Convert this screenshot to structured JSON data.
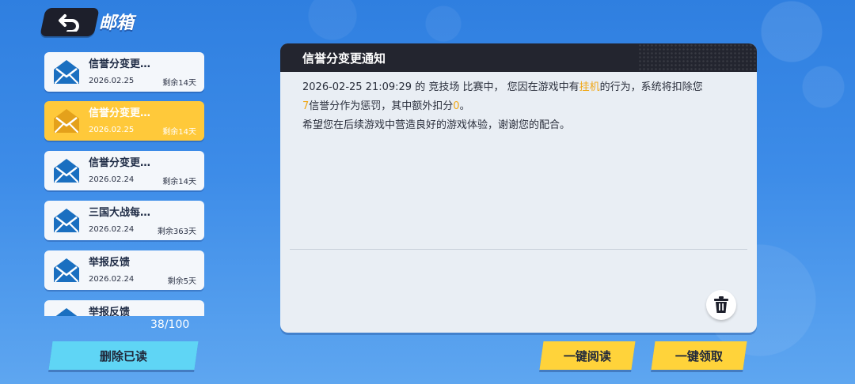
{
  "header": {
    "title": "邮箱",
    "back_icon": "back-arrow-icon"
  },
  "mail_list": {
    "items": [
      {
        "title": "信誉分变更…",
        "date": "2026.02.25",
        "remaining": "剩余14天",
        "selected": false
      },
      {
        "title": "信誉分变更…",
        "date": "2026.02.25",
        "remaining": "剩余14天",
        "selected": true
      },
      {
        "title": "信誉分变更…",
        "date": "2026.02.24",
        "remaining": "剩余14天",
        "selected": false
      },
      {
        "title": "三国大战每…",
        "date": "2026.02.24",
        "remaining": "剩余363天",
        "selected": false
      },
      {
        "title": "举报反馈",
        "date": "2026.02.24",
        "remaining": "剩余5天",
        "selected": false
      },
      {
        "title": "举报反馈",
        "date": "",
        "remaining": "",
        "selected": false
      }
    ],
    "count": "38/100"
  },
  "detail": {
    "title": "信誉分变更通知",
    "line1_a": "2026-02-25 21:09:29 的 竞技场 比赛中， 您因在游戏中有",
    "line1_hl": "挂机",
    "line1_b": "的行为，系统将扣除您",
    "line2_hl1": "7",
    "line2_a": "信誉分作为惩罚，其中额外扣分",
    "line2_hl2": "0",
    "line2_b": "。",
    "line3": "希望您在后续游戏中营造良好的游戏体验，谢谢您的配合。"
  },
  "buttons": {
    "delete_read": "删除已读",
    "read_all": "一键阅读",
    "claim_all": "一键领取"
  },
  "colors": {
    "selected_item": "#ffc93a",
    "highlight": "#f0a818",
    "envelope_blue": "#1a6fc0",
    "envelope_selected": "#e4a11b"
  }
}
